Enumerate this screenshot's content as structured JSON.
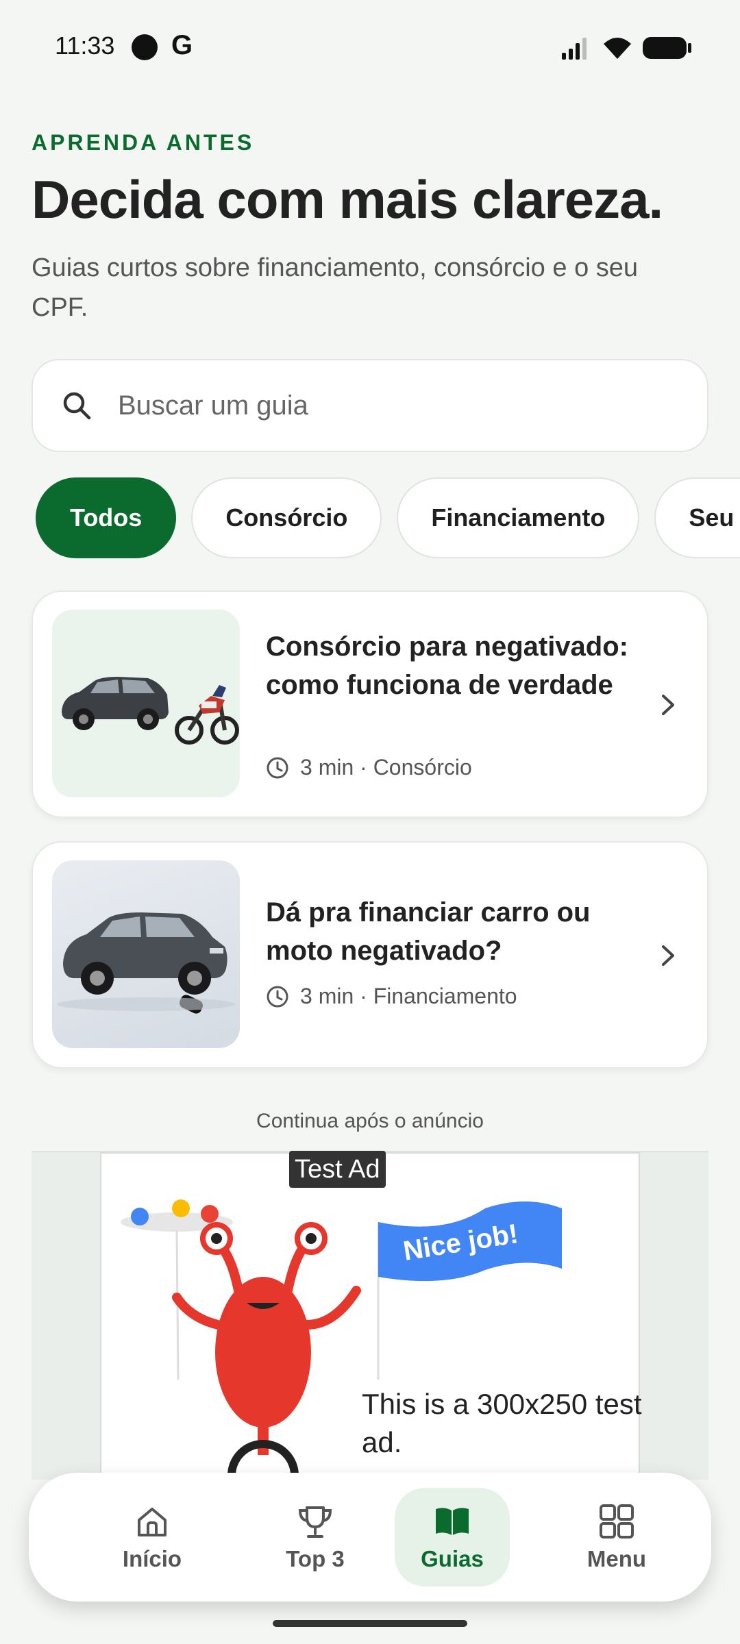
{
  "status_bar": {
    "time": "11:33",
    "g_label": "G"
  },
  "header": {
    "eyebrow": "APRENDA ANTES",
    "title": "Decida com mais clareza.",
    "subtitle": "Guias curtos sobre financiamento, consórcio e o seu CPF."
  },
  "search": {
    "placeholder": "Buscar um guia",
    "value": ""
  },
  "filters": {
    "chips": [
      {
        "label": "Todos",
        "active": true
      },
      {
        "label": "Consórcio",
        "active": false
      },
      {
        "label": "Financiamento",
        "active": false
      },
      {
        "label": "Seu CPF",
        "active": false
      }
    ]
  },
  "guides": [
    {
      "title": "Consórcio para negativado: como funciona de verdade",
      "meta": "3 min · Consórcio",
      "image": "car-and-motorcycle"
    },
    {
      "title": "Dá pra financiar carro ou moto negativado?",
      "meta": "3 min · Financiamento",
      "image": "car-with-key"
    }
  ],
  "ad": {
    "label": "Continua após o anúncio",
    "tag": "Test Ad",
    "flag_text": "Nice job!",
    "text": "This is a 300x250 test ad."
  },
  "bottom_nav": {
    "items": [
      {
        "label": "Início",
        "icon": "home-icon",
        "active": false
      },
      {
        "label": "Top 3",
        "icon": "trophy-icon",
        "active": false
      },
      {
        "label": "Guias",
        "icon": "book-icon",
        "active": true
      },
      {
        "label": "Menu",
        "icon": "grid-icon",
        "active": false
      }
    ]
  },
  "colors": {
    "accent": "#0b6b2e",
    "background": "#f4f6f4",
    "active_nav_bg": "#e6f2e8"
  }
}
